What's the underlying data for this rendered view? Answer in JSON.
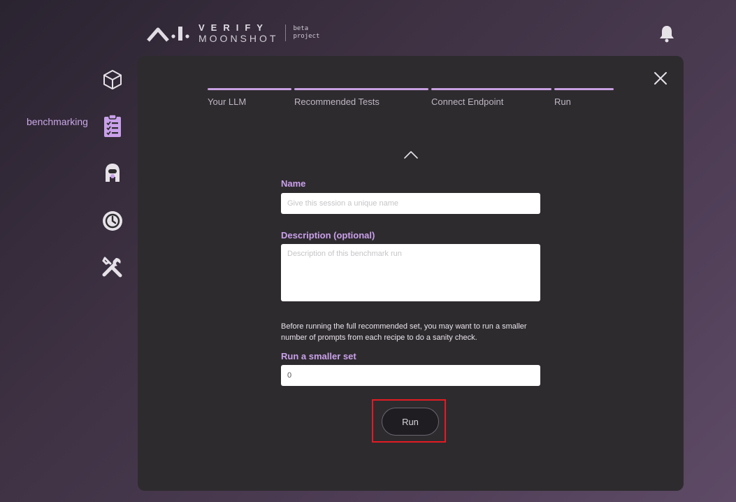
{
  "header": {
    "logo_verify": "VERIFY",
    "logo_moonshot": "MOONSHOT",
    "logo_beta_line1": "beta",
    "logo_beta_line2": "project"
  },
  "sidebar": {
    "items": [
      {
        "icon": "cube-icon",
        "label": ""
      },
      {
        "icon": "clipboard-checklist-icon",
        "label": "benchmarking"
      },
      {
        "icon": "red-teaming-agent-icon",
        "label": ""
      },
      {
        "icon": "history-icon",
        "label": ""
      },
      {
        "icon": "tools-icon",
        "label": ""
      }
    ]
  },
  "steps": [
    {
      "label": "Your LLM"
    },
    {
      "label": "Recommended Tests"
    },
    {
      "label": "Connect Endpoint"
    },
    {
      "label": "Run"
    }
  ],
  "form": {
    "name_label": "Name",
    "name_placeholder": "Give this session a unique name",
    "description_label": "Description (optional)",
    "description_placeholder": "Description of this benchmark run",
    "note": "Before running the full recommended set, you may want to run a smaller number of prompts from each recipe to do a sanity check.",
    "smaller_set_label": "Run a smaller set",
    "smaller_set_value": "0",
    "run_label": "Run"
  },
  "colors": {
    "accent": "#c9a0ea",
    "panel": "#2e2b2f",
    "highlight": "#e31b23"
  }
}
